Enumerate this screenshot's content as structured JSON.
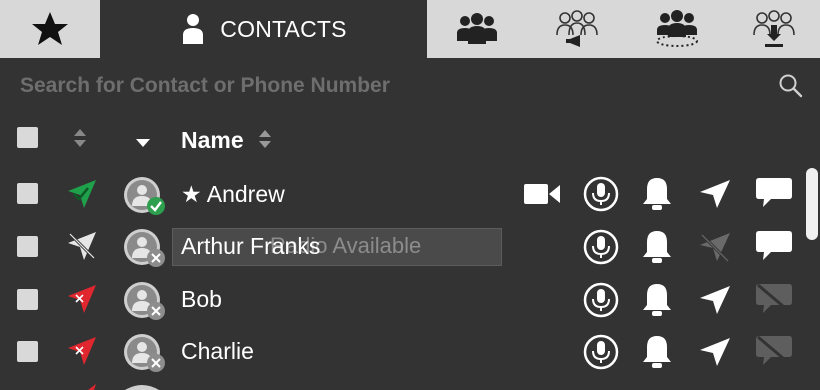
{
  "tabs": [
    {
      "icon": "star-icon",
      "label": ""
    },
    {
      "icon": "contact-icon",
      "label": "CONTACTS",
      "active": true
    },
    {
      "icon": "group-icon",
      "label": ""
    },
    {
      "icon": "group-broadcast-icon",
      "label": ""
    },
    {
      "icon": "group-dynamic-icon",
      "label": ""
    },
    {
      "icon": "group-download-icon",
      "label": ""
    }
  ],
  "search": {
    "placeholder": "Search for Contact or Phone Number"
  },
  "table": {
    "name_header": "Name"
  },
  "contacts": [
    {
      "name": "★ Andrew",
      "status": "online",
      "location": "green"
    },
    {
      "name": "Arthur Franks",
      "status": "offline",
      "location": "disabled"
    },
    {
      "name": "Bob",
      "status": "offline",
      "location": "red"
    },
    {
      "name": "Charlie",
      "status": "offline",
      "location": "red"
    }
  ],
  "tooltip": {
    "text": "Radio Available"
  },
  "colors": {
    "background": "#333333",
    "tabbar": "#d8d8d8",
    "online": "#2e9e4f",
    "location_green": "#1fa04a",
    "location_red": "#e0262e"
  }
}
